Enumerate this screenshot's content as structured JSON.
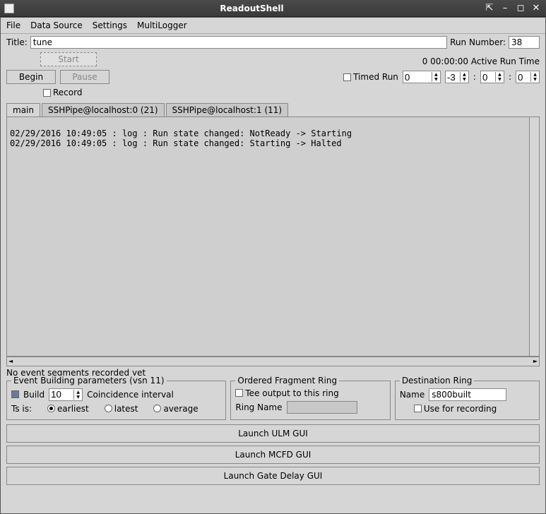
{
  "window": {
    "title": "ReadoutShell"
  },
  "menu": {
    "file": "File",
    "dataSource": "Data Source",
    "settings": "Settings",
    "multiLogger": "MultiLogger"
  },
  "titleField": {
    "label": "Title:",
    "value": "tune"
  },
  "runNumber": {
    "label": "Run Number:",
    "value": "38"
  },
  "buttons": {
    "start": "Start",
    "begin": "Begin",
    "pause": "Pause"
  },
  "activeRunTime": {
    "value": "0 00:00:00",
    "label": "Active Run Time"
  },
  "timedRun": {
    "label": "Timed Run",
    "h": "0",
    "m": "-3",
    "s1": "0",
    "s2": "0"
  },
  "record": {
    "label": "Record"
  },
  "tabs": [
    {
      "label": "main",
      "active": true
    },
    {
      "label": "SSHPipe@localhost:0 (21)",
      "active": false
    },
    {
      "label": "SSHPipe@localhost:1 (11)",
      "active": false
    }
  ],
  "log": [
    "02/29/2016 10:49:05 : log : Run state changed: NotReady -> Starting",
    "02/29/2016 10:49:05 : log : Run state changed: Starting -> Halted"
  ],
  "status": "No event segments recorded yet",
  "eventBuilding": {
    "legend": "Event Building parameters (vsn 11)",
    "buildLabel": "Build",
    "buildValue": "10",
    "coincLabel": "Coincidence interval",
    "tsLabel": "Ts is:",
    "opts": {
      "earliest": "earliest",
      "latest": "latest",
      "average": "average"
    }
  },
  "orderedRing": {
    "legend": "Ordered Fragment Ring",
    "teeLabel": "Tee output to this ring",
    "ringNameLabel": "Ring Name",
    "ringNameValue": ""
  },
  "destRing": {
    "legend": "Destination Ring",
    "nameLabel": "Name",
    "nameValue": "s800built",
    "useLabel": "Use for recording"
  },
  "launch": {
    "ulm": "Launch ULM GUI",
    "mcfd": "Launch MCFD GUI",
    "gate": "Launch Gate Delay GUI"
  }
}
